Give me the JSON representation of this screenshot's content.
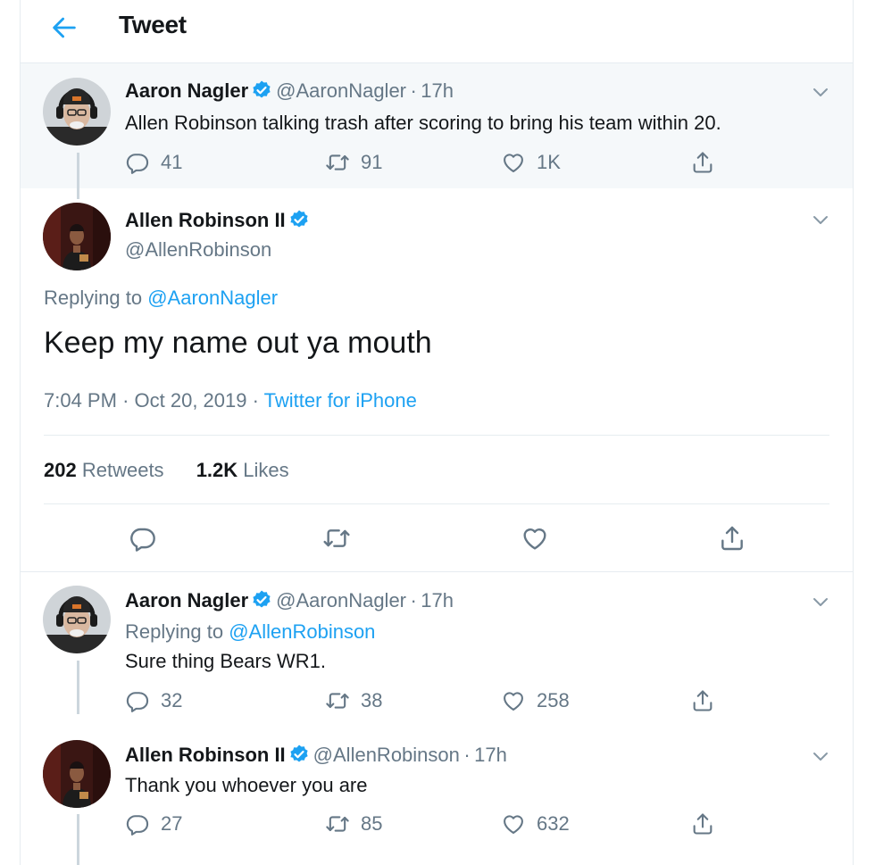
{
  "header": {
    "title": "Tweet"
  },
  "icons": {
    "back": "arrow-left-icon",
    "verified": "verified-badge-icon",
    "more": "chevron-down-icon",
    "reply": "reply-icon",
    "retweet": "retweet-icon",
    "like": "heart-icon",
    "share": "share-icon"
  },
  "colors": {
    "accent": "#1da1f2",
    "muted": "#657786",
    "text": "#14171a",
    "ancestor_bg": "#f5f8fa",
    "border": "#e6ecf0"
  },
  "ancestor": {
    "name": "Aaron Nagler",
    "handle": "@AaronNagler",
    "sep": "·",
    "time": "17h",
    "text": "Allen Robinson talking trash after scoring to bring his team within 20.",
    "replies": "41",
    "retweets": "91",
    "likes": "1K"
  },
  "main": {
    "name": "Allen Robinson II",
    "handle": "@AllenRobinson",
    "replying_prefix": "Replying to",
    "replying_to": "@AaronNagler",
    "text": "Keep my name out ya mouth",
    "time": "7:04 PM",
    "sep1": "·",
    "date": "Oct 20, 2019",
    "sep2": "·",
    "source": "Twitter for iPhone",
    "retweets_count": "202",
    "retweets_label": "Retweets",
    "likes_count": "1.2K",
    "likes_label": "Likes"
  },
  "reply1": {
    "name": "Aaron Nagler",
    "handle": "@AaronNagler",
    "sep": "·",
    "time": "17h",
    "replying_prefix": "Replying to",
    "replying_to": "@AllenRobinson",
    "text": "Sure thing Bears WR1.",
    "replies": "32",
    "retweets": "38",
    "likes": "258"
  },
  "reply2": {
    "name": "Allen Robinson II",
    "handle": "@AllenRobinson",
    "sep": "·",
    "time": "17h",
    "text": "Thank you whoever you are",
    "replies": "27",
    "retweets": "85",
    "likes": "632"
  }
}
